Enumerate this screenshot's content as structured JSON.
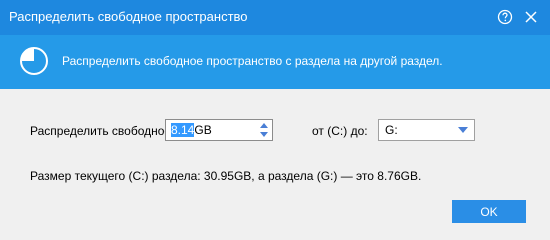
{
  "window": {
    "title": "Распределить свободное пространство",
    "help_icon": "help-icon",
    "close_icon": "close-icon",
    "title_bar_color": "#1e88df"
  },
  "banner": {
    "icon": "pie-chart-icon",
    "text": "Распределить свободное пространство с раздела на другой раздел.",
    "color": "#259ae8"
  },
  "form": {
    "distribute_label": "Распределить свободное",
    "amount_value_selected": "8.14",
    "amount_unit": "GB",
    "from_to_label": "от (C:) до:",
    "target_drive": "G:"
  },
  "info": {
    "text": "Размер текущего (C:) раздела: 30.95GB, а раздела (G:) — это 8.76GB."
  },
  "buttons": {
    "ok_label": "OK",
    "ok_color": "#2a8ee6"
  }
}
